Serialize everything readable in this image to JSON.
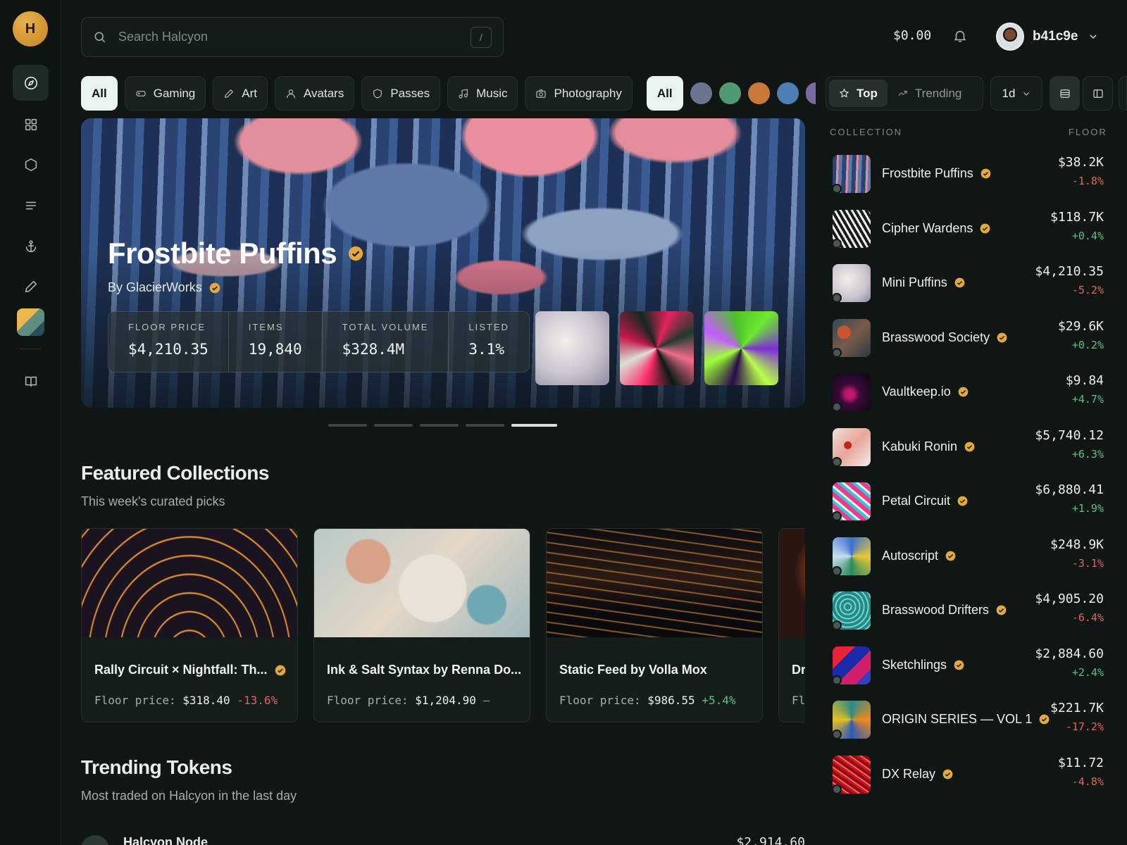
{
  "app": {
    "logo_letter": "H"
  },
  "search": {
    "placeholder": "Search Halcyon",
    "shortcut": "/"
  },
  "header": {
    "balance": "$0.00",
    "username": "b41c9e"
  },
  "categories": [
    "All",
    "Gaming",
    "Art",
    "Avatars",
    "Passes",
    "Music",
    "Photography"
  ],
  "chain_filter": {
    "label": "All",
    "dot_colors": [
      "#6c7590",
      "#4f9a74",
      "#c9783a",
      "#4d7fb5",
      "#7a6aa0"
    ]
  },
  "hero": {
    "title": "Frostbite Puffins",
    "by": "By GlacierWorks",
    "stats": [
      {
        "label": "FLOOR PRICE",
        "value": "$4,210.35"
      },
      {
        "label": "ITEMS",
        "value": "19,840"
      },
      {
        "label": "TOTAL VOLUME",
        "value": "$328.4M"
      },
      {
        "label": "LISTED",
        "value": "3.1%"
      }
    ],
    "carousel": {
      "pages": 5,
      "active": 5
    }
  },
  "featured": {
    "title": "Featured Collections",
    "subtitle": "This week's curated picks",
    "floor_label": "Floor price:",
    "cards": [
      {
        "title": "Rally Circuit × Nightfall: Th...",
        "verified": true,
        "floor": "$318.40",
        "change": "-13.6%",
        "trend": "neg"
      },
      {
        "title": "Ink & Salt Syntax by Renna Do...",
        "verified": false,
        "floor": "$1,204.90",
        "change": "—",
        "trend": "neu"
      },
      {
        "title": "Static Feed by Volla Mox",
        "verified": false,
        "floor": "$986.55",
        "change": "+5.4%",
        "trend": "pos"
      },
      {
        "title": "Dri",
        "verified": false,
        "floor": "",
        "change": "",
        "trend": "neu",
        "floor_label_partial": "Flo"
      }
    ]
  },
  "trending": {
    "title": "Trending Tokens",
    "subtitle": "Most traded on Halcyon in the last day",
    "rows": [
      {
        "name": "Halcyon Node",
        "price": "$2,914.60"
      }
    ]
  },
  "rankings": {
    "tabs": [
      "Top",
      "Trending"
    ],
    "active_tab": "Top",
    "period": "1d",
    "col_collection": "COLLECTION",
    "col_floor": "FLOOR",
    "rows": [
      {
        "name": "Frostbite Puffins",
        "floor": "$38.2K",
        "change": "-1.8%",
        "trend": "neg"
      },
      {
        "name": "Cipher Wardens",
        "floor": "$118.7K",
        "change": "+0.4%",
        "trend": "pos"
      },
      {
        "name": "Mini Puffins",
        "floor": "$4,210.35",
        "change": "-5.2%",
        "trend": "neg"
      },
      {
        "name": "Brasswood Society",
        "floor": "$29.6K",
        "change": "+0.2%",
        "trend": "pos"
      },
      {
        "name": "Vaultkeep.io",
        "floor": "$9.84",
        "change": "+4.7%",
        "trend": "pos"
      },
      {
        "name": "Kabuki Ronin",
        "floor": "$5,740.12",
        "change": "+6.3%",
        "trend": "pos"
      },
      {
        "name": "Petal Circuit",
        "floor": "$6,880.41",
        "change": "+1.9%",
        "trend": "pos"
      },
      {
        "name": "Autoscript",
        "floor": "$248.9K",
        "change": "-3.1%",
        "trend": "neg"
      },
      {
        "name": "Brasswood Drifters",
        "floor": "$4,905.20",
        "change": "-6.4%",
        "trend": "neg"
      },
      {
        "name": "Sketchlings",
        "floor": "$2,884.60",
        "change": "+2.4%",
        "trend": "pos"
      },
      {
        "name": "ORIGIN SERIES — VOL 1",
        "floor": "$221.7K",
        "change": "-17.2%",
        "trend": "neg"
      },
      {
        "name": "DX Relay",
        "floor": "$11.72",
        "change": "-4.8%",
        "trend": "neg"
      }
    ]
  },
  "colors": {
    "accent_gold": "#e2a93b",
    "positive": "#5bbf86",
    "negative": "#e0655a",
    "background": "#0f1614"
  }
}
